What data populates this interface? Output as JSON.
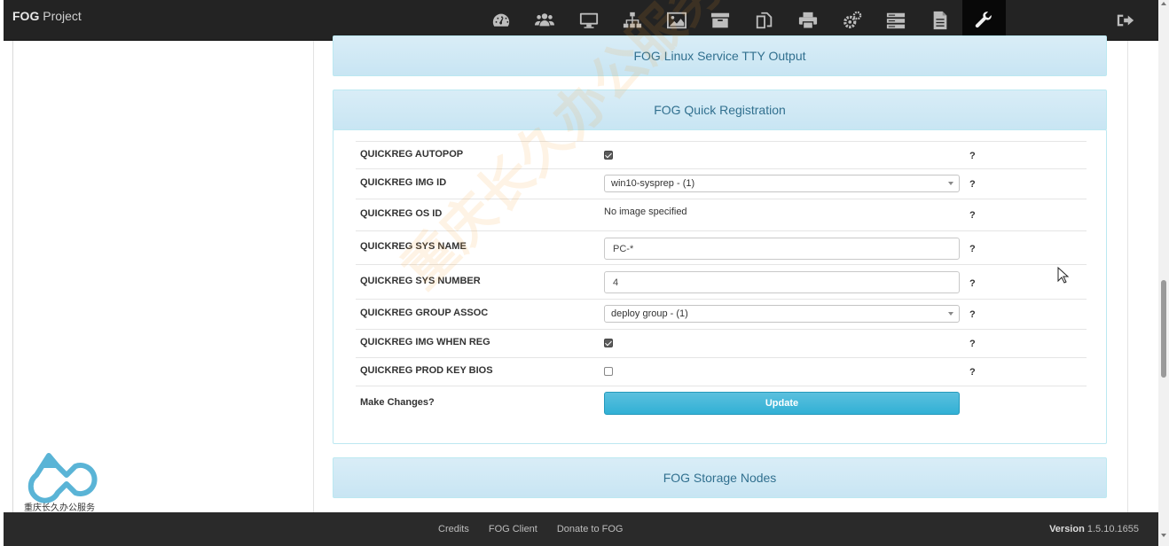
{
  "brand": {
    "bold": "FOG",
    "rest": " Project"
  },
  "nav": {
    "icons": [
      "dashboard-icon",
      "users-icon",
      "hosts-monitor-icon",
      "groups-sitemap-icon",
      "images-icon",
      "storage-archive-icon",
      "snapins-copy-icon",
      "printer-icon",
      "services-gears-icon",
      "tasks-server-icon",
      "reports-document-icon",
      "settings-wrench-icon"
    ],
    "active": "settings-wrench-icon",
    "logout_icon": "logout-icon"
  },
  "sections": {
    "tty": "FOG Linux Service TTY Output",
    "quickreg": "FOG Quick Registration",
    "storage": "FOG Storage Nodes"
  },
  "quickreg": {
    "autopop_label": "QUICKREG AUTOPOP",
    "autopop_checked": true,
    "img_id_label": "QUICKREG IMG ID",
    "img_id_value": "win10-sysprep - (1)",
    "os_id_label": "QUICKREG OS ID",
    "os_id_value": "No image specified",
    "sys_name_label": "QUICKREG SYS NAME",
    "sys_name_value": "PC-*",
    "sys_number_label": "QUICKREG SYS NUMBER",
    "sys_number_value": "4",
    "group_assoc_label": "QUICKREG GROUP ASSOC",
    "group_assoc_value": "deploy group - (1)",
    "img_when_reg_label": "QUICKREG IMG WHEN REG",
    "img_when_reg_checked": true,
    "prod_key_bios_label": "QUICKREG PROD KEY BIOS",
    "prod_key_bios_checked": false,
    "make_changes_label": "Make Changes?",
    "update_label": "Update",
    "help": "?"
  },
  "watermark": "重庆长久办公服务",
  "logo_text": "重庆长久办公服务",
  "footer": {
    "links": [
      "Credits",
      "FOG Client",
      "Donate to FOG"
    ],
    "version_label": "Version",
    "version_value": "1.5.10.1655"
  }
}
